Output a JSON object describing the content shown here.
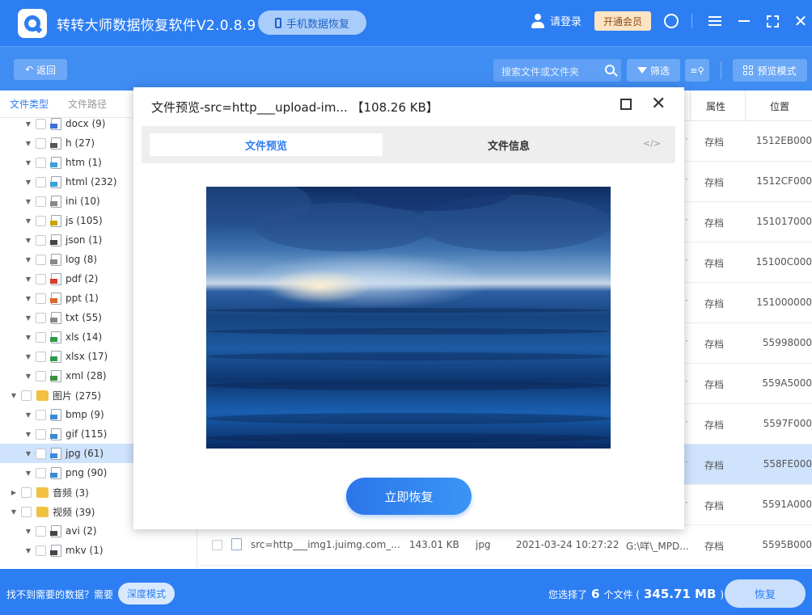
{
  "app": {
    "title": "转转大师数据恢复软件V2.0.8.9",
    "phone_recovery": "手机数据恢复",
    "login": "请登录",
    "vip": "开通会员"
  },
  "toolbar": {
    "back": "返回",
    "search_placeholder": "搜索文件或文件夹",
    "filter": "筛选",
    "preview_mode": "预览模式"
  },
  "sidebar": {
    "tabs": [
      "文件类型",
      "文件路径"
    ],
    "items": [
      {
        "label": "docx (9)",
        "level": 1,
        "icon": "doc"
      },
      {
        "label": "h (27)",
        "level": 1,
        "icon": "h"
      },
      {
        "label": "htm (1)",
        "level": 1,
        "icon": "web"
      },
      {
        "label": "html (232)",
        "level": 1,
        "icon": "web"
      },
      {
        "label": "ini (10)",
        "level": 1,
        "icon": "ini"
      },
      {
        "label": "js (105)",
        "level": 1,
        "icon": "js"
      },
      {
        "label": "json (1)",
        "level": 1,
        "icon": "json"
      },
      {
        "label": "log (8)",
        "level": 1,
        "icon": "log"
      },
      {
        "label": "pdf (2)",
        "level": 1,
        "icon": "pdf"
      },
      {
        "label": "ppt (1)",
        "level": 1,
        "icon": "ppt"
      },
      {
        "label": "txt (55)",
        "level": 1,
        "icon": "txt"
      },
      {
        "label": "xls (14)",
        "level": 1,
        "icon": "xls"
      },
      {
        "label": "xlsx (17)",
        "level": 1,
        "icon": "xls"
      },
      {
        "label": "xml (28)",
        "level": 1,
        "icon": "xml"
      },
      {
        "label": "图片 (275)",
        "level": 0,
        "icon": "folder",
        "expanded": true
      },
      {
        "label": "bmp (9)",
        "level": 1,
        "icon": "img"
      },
      {
        "label": "gif (115)",
        "level": 1,
        "icon": "img"
      },
      {
        "label": "jpg (61)",
        "level": 1,
        "icon": "img",
        "selected": true
      },
      {
        "label": "png (90)",
        "level": 1,
        "icon": "img"
      },
      {
        "label": "音频 (3)",
        "level": 0,
        "icon": "folder",
        "expanded": false
      },
      {
        "label": "视频 (39)",
        "level": 0,
        "icon": "folder",
        "expanded": true
      },
      {
        "label": "avi (2)",
        "level": 1,
        "icon": "video"
      },
      {
        "label": "mkv (1)",
        "level": 1,
        "icon": "video"
      }
    ]
  },
  "table": {
    "headers": {
      "attr": "属性",
      "position": "位置"
    },
    "rows": [
      {
        "attr": "存档",
        "position": "1512EB000"
      },
      {
        "attr": "存档",
        "position": "1512CF000"
      },
      {
        "attr": "存档",
        "position": "151017000"
      },
      {
        "attr": "存档",
        "position": "15100C000"
      },
      {
        "attr": "存档",
        "position": "151000000"
      },
      {
        "attr": "存档",
        "position": "55998000"
      },
      {
        "attr": "存档",
        "position": "559A5000"
      },
      {
        "attr": "存档",
        "position": "5597F000"
      },
      {
        "attr": "存档",
        "position": "558FE000",
        "selected": true
      },
      {
        "attr": "存档",
        "position": "5591A000"
      }
    ],
    "full_row": {
      "name": "src=http___img1.juimg.com_...",
      "size": "143.01 KB",
      "type": "jpg",
      "date": "2021-03-24 10:27:22",
      "path": "G:\\咩\\_MPD...",
      "attr": "存档",
      "position": "5595B000"
    }
  },
  "modal": {
    "title": "文件预览-src=http___upload-im... 【108.26 KB】",
    "tab_preview": "文件预览",
    "tab_info": "文件信息",
    "code_icon": "</>",
    "recover_now": "立即恢复"
  },
  "bottom": {
    "not_found": "找不到需要的数据？需要",
    "deep_mode": "深度模式",
    "selected_prefix": "您选择了",
    "selected_count": "6",
    "selected_mid": "个文件 (",
    "selected_size": "345.71 MB",
    "selected_suffix": ")",
    "recover": "恢复"
  },
  "colors": {
    "primary": "#2d7ef2",
    "selected_row": "#cfe3fd",
    "vip_bg": "#fde4c5"
  }
}
